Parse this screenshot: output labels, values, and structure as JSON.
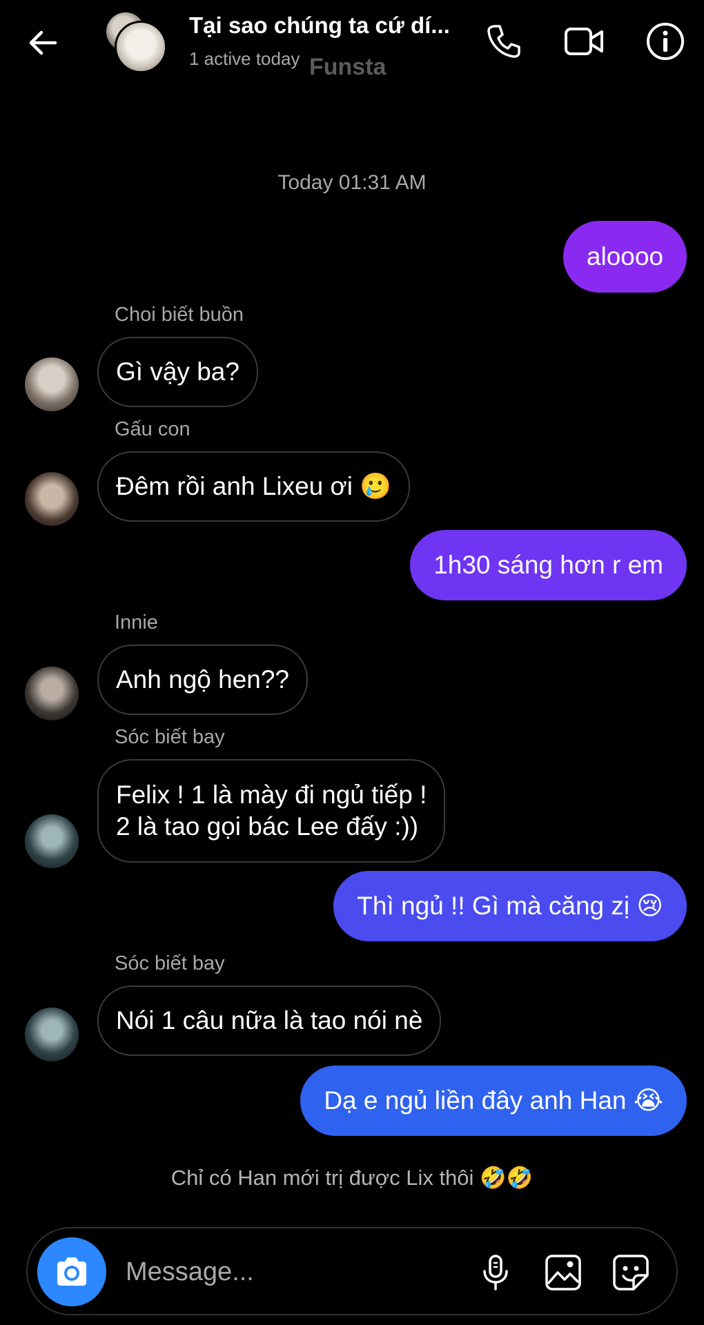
{
  "header": {
    "title": "Tại sao chúng ta cứ dí...",
    "subtitle": "1 active today",
    "watermark": "Funsta"
  },
  "chat": {
    "timestamp": "Today 01:31 AM",
    "messages": [
      {
        "direction": "outgoing",
        "text": "aloooo",
        "color": "#8a2af0"
      },
      {
        "direction": "incoming",
        "sender": "Choi biết buồn",
        "text": "Gì vậy ba?"
      },
      {
        "direction": "incoming",
        "sender": "Gấu con",
        "text": "Đêm rồi anh Lixeu ơi",
        "emoji": "🥲"
      },
      {
        "direction": "outgoing",
        "text": "1h30 sáng hơn r em",
        "color": "#6f35f2"
      },
      {
        "direction": "incoming",
        "sender": "Innie",
        "text": "Anh ngộ hen??"
      },
      {
        "direction": "incoming",
        "sender": "Sóc biết bay",
        "text": "Felix ! 1 là mày đi ngủ tiếp !\n2 là tao gọi bác Lee đấy :))"
      },
      {
        "direction": "outgoing",
        "text": "Thì ngủ !! Gì mà căng zị",
        "emoji": "😢",
        "color": "#4a4cf0"
      },
      {
        "direction": "incoming",
        "sender": "Sóc biết bay",
        "text": "Nói 1 câu nữa là tao nói nè"
      },
      {
        "direction": "outgoing",
        "text": "Dạ e ngủ liền đây anh Han",
        "emoji": "😭",
        "color": "#2f62ee"
      }
    ],
    "footer_note": "Chỉ có Han mới trị được Lix thôi",
    "footer_emoji": "🤣🤣"
  },
  "composer": {
    "placeholder": "Message..."
  },
  "icons": {
    "back": "arrow-left-icon",
    "call": "phone-icon",
    "video": "video-camera-icon",
    "info": "info-icon",
    "camera": "camera-icon",
    "mic": "microphone-icon",
    "gallery": "image-icon",
    "sticker": "sticker-icon"
  },
  "colors": {
    "background": "#000000",
    "camera_button": "#2d88ff",
    "incoming_border": "#3a3a3a"
  }
}
